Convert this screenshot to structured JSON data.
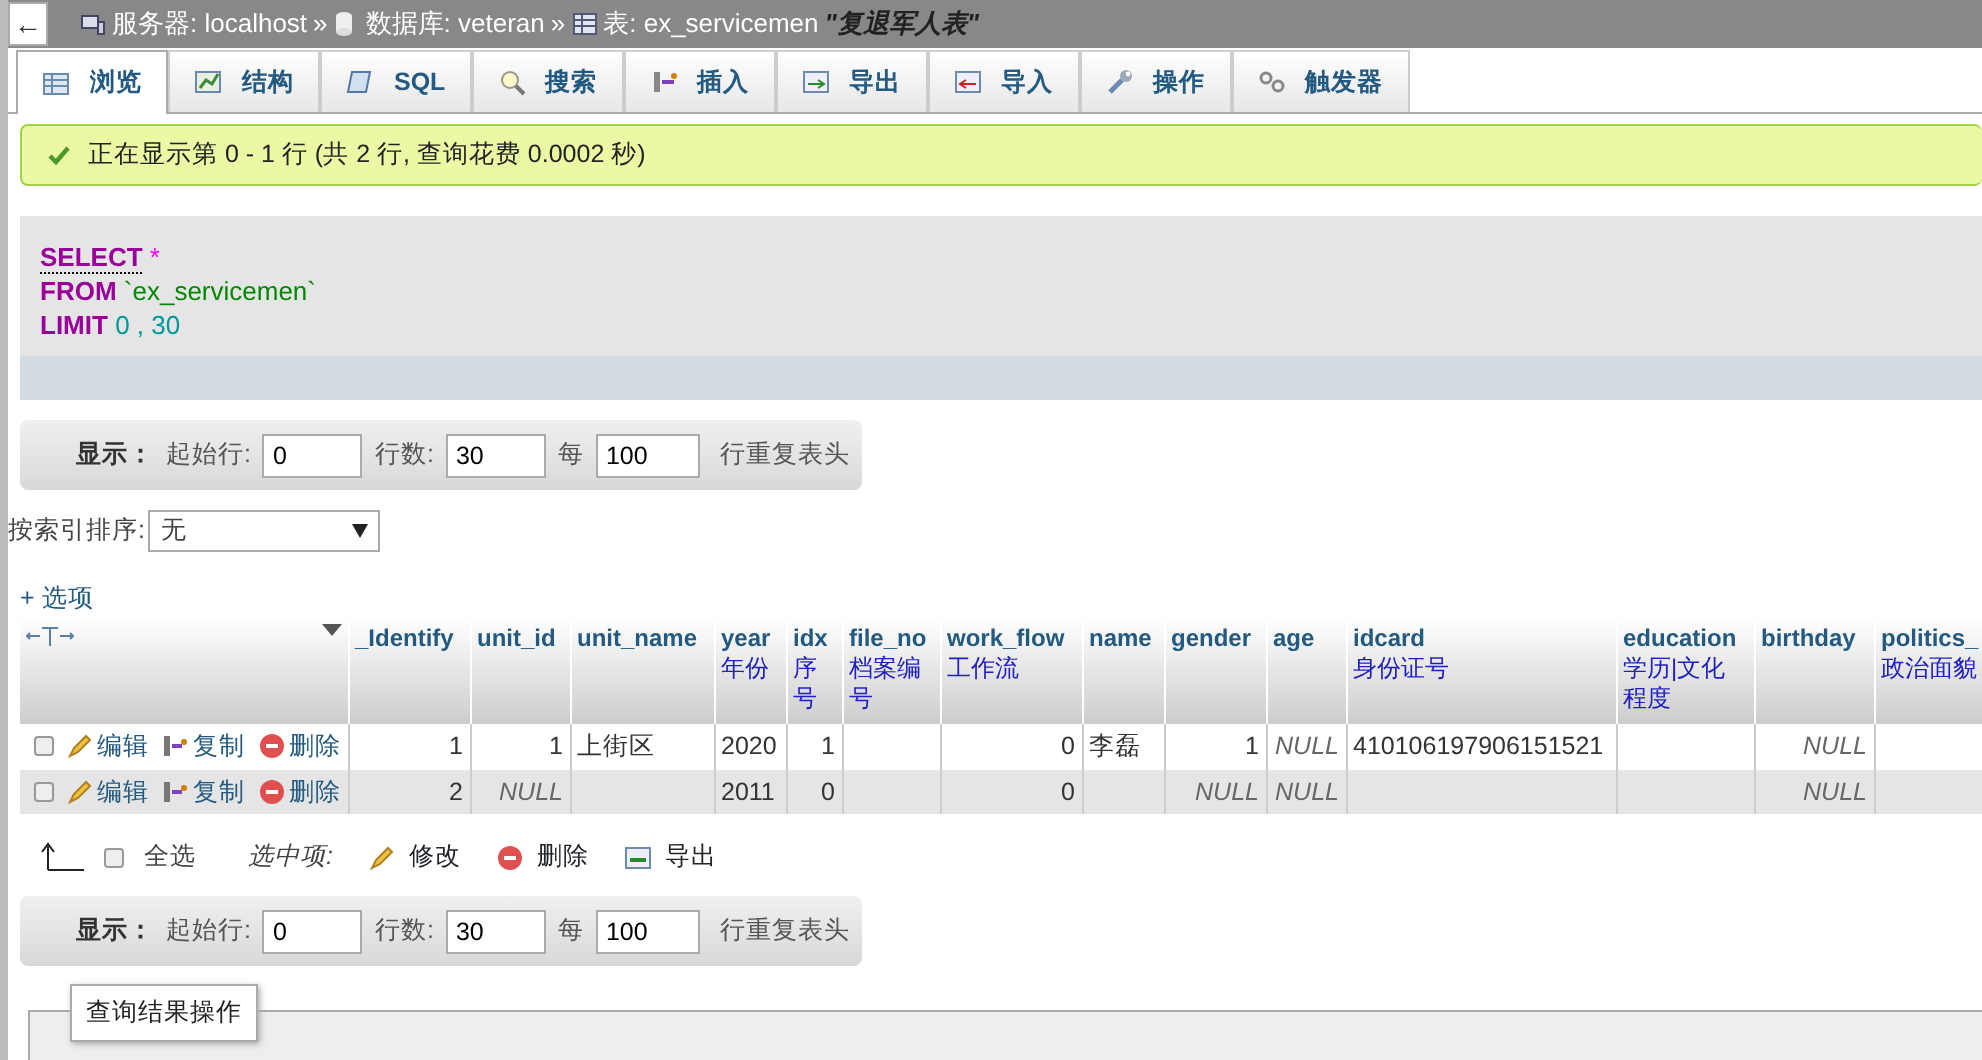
{
  "back_button": "←",
  "breadcrumb": [
    {
      "kind": "server",
      "label": "服务器: localhost",
      "separator": "»"
    },
    {
      "kind": "database",
      "label": "数据库: veteran",
      "separator": "»"
    },
    {
      "kind": "table",
      "label": "表: ex_servicemen",
      "comment": "\"复退军人表\""
    }
  ],
  "tabs": [
    {
      "label": "浏览",
      "selected": true
    },
    {
      "label": "结构",
      "selected": false
    },
    {
      "label": "SQL",
      "selected": false
    },
    {
      "label": "搜索",
      "selected": false
    },
    {
      "label": "插入",
      "selected": false
    },
    {
      "label": "导出",
      "selected": false
    },
    {
      "label": "导入",
      "selected": false
    },
    {
      "label": "操作",
      "selected": false
    },
    {
      "label": "触发器",
      "selected": false
    }
  ],
  "message": "正在显示第 0 - 1 行 (共 2 行, 查询花费 0.0002 秒)",
  "sql": [
    [
      {
        "kind": "keyword",
        "text": "SELECT"
      },
      {
        "kind": "operator",
        "text": "*"
      }
    ],
    [
      {
        "kind": "keyword",
        "text": "FROM"
      },
      {
        "kind": "identifier",
        "text": "`ex_servicemen`"
      }
    ],
    [
      {
        "kind": "keyword",
        "text": "LIMIT"
      },
      {
        "kind": "number",
        "text": "0 , 30"
      }
    ]
  ],
  "navigation_top": {
    "label": "显示：",
    "start_label": "起始行:",
    "start": "0",
    "rows_label": "行数:",
    "rows": "30",
    "per_label": "每",
    "per": "100",
    "tail": "行重复表头"
  },
  "sort": {
    "label": "按索引排序:",
    "value": "无"
  },
  "options_link": "+ 选项",
  "table": {
    "columns": [
      {
        "name": "_Identify",
        "kind": "number"
      },
      {
        "name": "unit_id",
        "kind": "number"
      },
      {
        "name": "unit_name",
        "kind": "text"
      },
      {
        "name": "year",
        "comment": "年份",
        "kind": "text"
      },
      {
        "name": "idx",
        "comment": "序号",
        "kind": "number"
      },
      {
        "name": "file_no",
        "comment": "档案编号",
        "kind": "text"
      },
      {
        "name": "work_flow",
        "comment": "工作流",
        "kind": "number"
      },
      {
        "name": "name",
        "kind": "text"
      },
      {
        "name": "gender",
        "kind": "number"
      },
      {
        "name": "age",
        "kind": "number"
      },
      {
        "name": "idcard",
        "comment": "身份证号",
        "kind": "text"
      },
      {
        "name": "education",
        "comment": "学历|文化程度",
        "kind": "text"
      },
      {
        "name": "birthday",
        "kind": "number"
      },
      {
        "name": "politics_",
        "comment": "政治面貌",
        "kind": "text"
      }
    ],
    "rows": [
      {
        "checked": false,
        "actions": [
          "编辑",
          "复制",
          "删除"
        ],
        "cells": [
          {
            "text": "1"
          },
          {
            "text": "1"
          },
          {
            "text": "上街区"
          },
          {
            "text": "2020"
          },
          {
            "text": "1"
          },
          {
            "text": ""
          },
          {
            "text": "0"
          },
          {
            "text": "李磊"
          },
          {
            "text": "1"
          },
          {
            "text": "NULL",
            "null": true
          },
          {
            "text": "410106197906151521"
          },
          {
            "text": ""
          },
          {
            "text": "NULL",
            "null": true
          },
          {
            "text": ""
          }
        ]
      },
      {
        "checked": false,
        "actions": [
          "编辑",
          "复制",
          "删除"
        ],
        "cells": [
          {
            "text": "2"
          },
          {
            "text": "NULL",
            "null": true
          },
          {
            "text": ""
          },
          {
            "text": "2011"
          },
          {
            "text": "0"
          },
          {
            "text": ""
          },
          {
            "text": "0"
          },
          {
            "text": ""
          },
          {
            "text": "NULL",
            "null": true
          },
          {
            "text": "NULL",
            "null": true
          },
          {
            "text": ""
          },
          {
            "text": ""
          },
          {
            "text": "NULL",
            "null": true
          },
          {
            "text": ""
          }
        ]
      }
    ]
  },
  "bulk": {
    "check_all": "全选",
    "checked": false,
    "with_selected": "选中项:",
    "actions": [
      "修改",
      "删除",
      "导出"
    ]
  },
  "navigation_bottom": {
    "label": "显示：",
    "start_label": "起始行:",
    "start": "0",
    "rows_label": "行数:",
    "rows": "30",
    "per_label": "每",
    "per": "100",
    "tail": "行重复表头"
  },
  "fieldset_legend": "查询结果操作"
}
